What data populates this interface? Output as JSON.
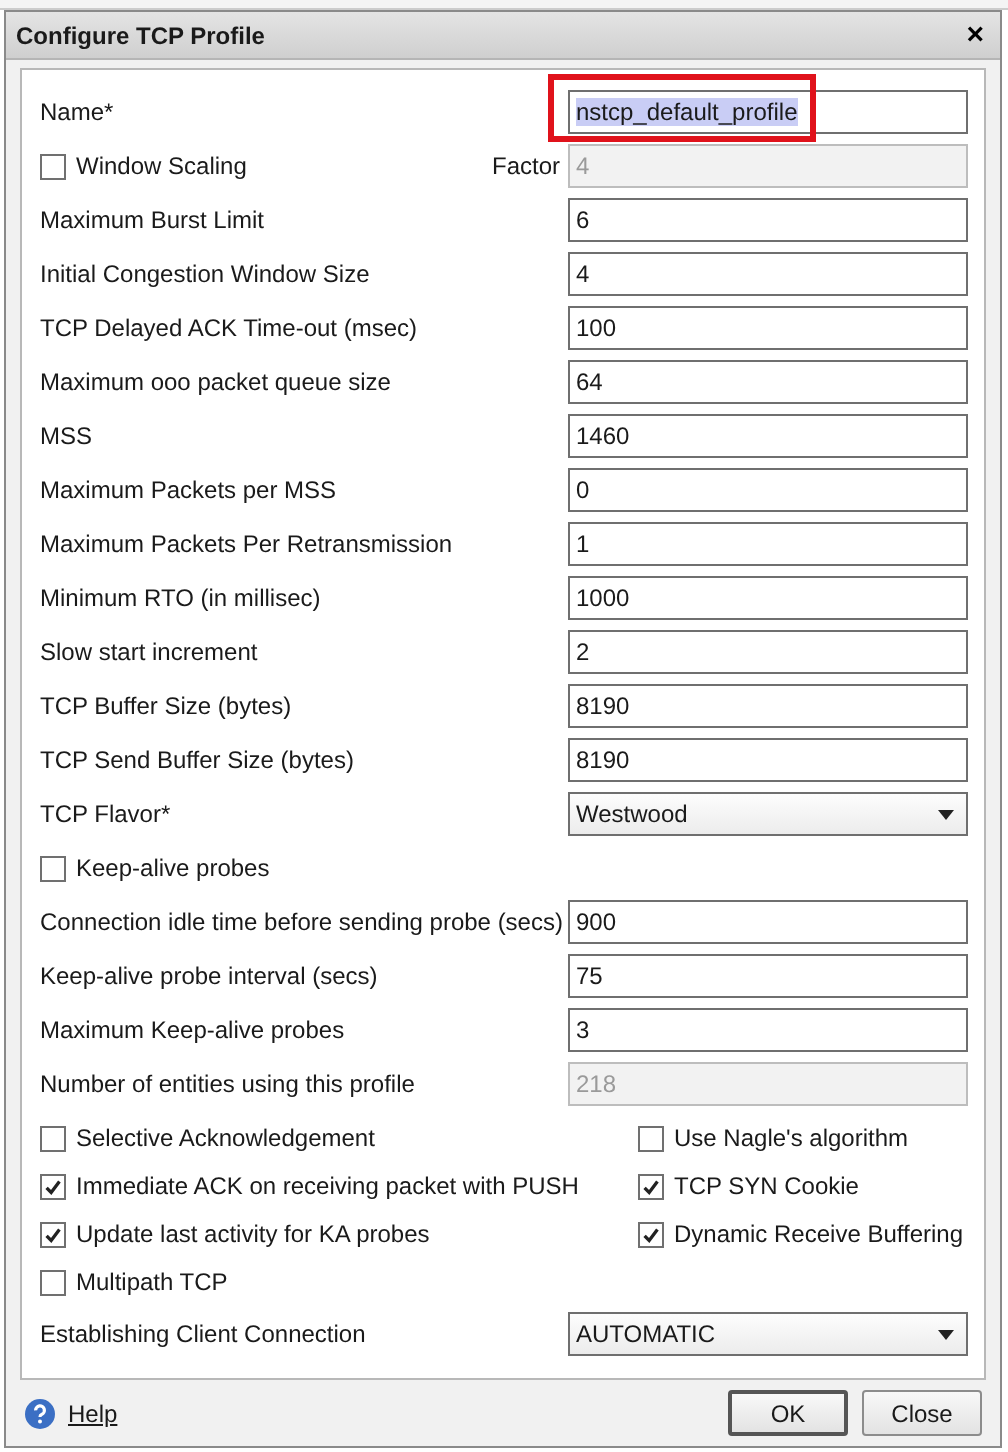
{
  "window": {
    "title": "Configure TCP Profile",
    "close": "×"
  },
  "fields": [
    {
      "kind": "text",
      "label": "Name*",
      "value": "nstcp_default_profile",
      "disabled": false,
      "text_selected": true,
      "highlighted": true
    },
    {
      "kind": "check_factor",
      "label": "Window Scaling",
      "checked": false,
      "factor_label": "Factor",
      "value": "4",
      "disabled": true
    },
    {
      "kind": "text",
      "label": "Maximum Burst Limit",
      "value": "6",
      "disabled": false
    },
    {
      "kind": "text",
      "label": "Initial Congestion Window Size",
      "value": "4",
      "disabled": false
    },
    {
      "kind": "text",
      "label": "TCP Delayed ACK Time-out (msec)",
      "value": "100",
      "disabled": false
    },
    {
      "kind": "text",
      "label": "Maximum ooo packet queue size",
      "value": "64",
      "disabled": false
    },
    {
      "kind": "text",
      "label": "MSS",
      "value": "1460",
      "disabled": false
    },
    {
      "kind": "text",
      "label": "Maximum Packets per MSS",
      "value": "0",
      "disabled": false
    },
    {
      "kind": "text",
      "label": "Maximum Packets Per Retransmission",
      "value": "1",
      "disabled": false
    },
    {
      "kind": "text",
      "label": "Minimum RTO (in millisec)",
      "value": "1000",
      "disabled": false
    },
    {
      "kind": "text",
      "label": "Slow start increment",
      "value": "2",
      "disabled": false
    },
    {
      "kind": "text",
      "label": "TCP Buffer Size (bytes)",
      "value": "8190",
      "disabled": false
    },
    {
      "kind": "text",
      "label": "TCP Send Buffer Size (bytes)",
      "value": "8190",
      "disabled": false
    },
    {
      "kind": "select",
      "label": "TCP Flavor*",
      "value": "Westwood"
    },
    {
      "kind": "check",
      "label": "Keep-alive probes",
      "checked": false
    },
    {
      "kind": "text",
      "label": "Connection idle time before sending probe (secs)",
      "value": "900",
      "disabled": false
    },
    {
      "kind": "text",
      "label": "Keep-alive probe interval (secs)",
      "value": "75",
      "disabled": false
    },
    {
      "kind": "text",
      "label": "Maximum Keep-alive probes",
      "value": "3",
      "disabled": false
    },
    {
      "kind": "text",
      "label": "Number of entities using this profile",
      "value": "218",
      "disabled": true
    }
  ],
  "options": [
    {
      "label": "Selective Acknowledgement",
      "checked": false
    },
    {
      "label": "Use Nagle's algorithm",
      "checked": false
    },
    {
      "label": "Immediate ACK on receiving packet with PUSH",
      "checked": true
    },
    {
      "label": "TCP SYN Cookie",
      "checked": true
    },
    {
      "label": "Update last activity for KA probes",
      "checked": true
    },
    {
      "label": "Dynamic Receive Buffering",
      "checked": true
    },
    {
      "label": "Multipath TCP",
      "checked": false
    }
  ],
  "client_connection": {
    "label": "Establishing Client Connection",
    "value": "AUTOMATIC"
  },
  "footer": {
    "help": "Help",
    "buttons": [
      {
        "label": "OK",
        "default": true
      },
      {
        "label": "Close",
        "default": false
      }
    ]
  }
}
